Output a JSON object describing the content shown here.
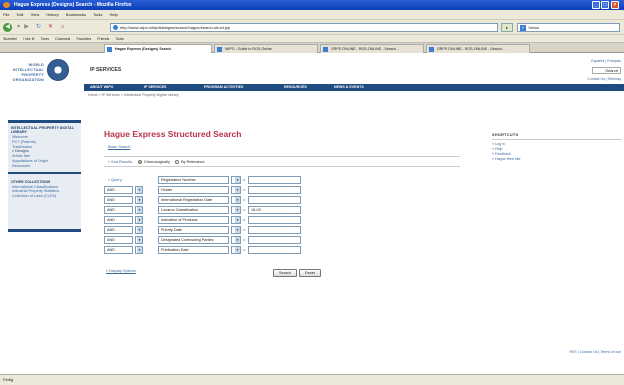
{
  "window": {
    "title": "Hague Express (Designs) Search - Mozilla Firefox"
  },
  "menu": [
    "File",
    "Edit",
    "View",
    "History",
    "Bookmarks",
    "Tools",
    "Help"
  ],
  "nav": {
    "url": "http://www.wipo.int/ipdldesigns/search/hague/search-struct.jsp",
    "go": "▸",
    "search_placeholder": "Yahoo",
    "search_engine": "Y"
  },
  "bookmarks": [
    "Stumble!",
    "I like it!",
    "Tools",
    "Channels",
    "Favorites",
    "Friends",
    "Tools"
  ],
  "tabs": [
    {
      "label": "Hague Express (Designs) Search"
    },
    {
      "label": "WIPO - Guide to ROS-Online"
    },
    {
      "label": "GRPS ONLINE - ROS-ONLINE - Search..."
    },
    {
      "label": "GRPS ONLINE - ROS-ONLINE - Search..."
    }
  ],
  "header": {
    "logo_lines": [
      "WORLD",
      "INTELLECTUAL",
      "PROPERTY",
      "ORGANIZATION"
    ],
    "ip_services": "IP SERVICES",
    "lang": "Español | Français",
    "search_btn": "Search",
    "contact": "Contact Us | Sitemap"
  },
  "topnav": [
    "ABOUT WIPO",
    "IP SERVICES",
    "PROGRAM ACTIVITIES",
    "RESOURCES",
    "NEWS & EVENTS"
  ],
  "breadcrumb": "Home > IP Services > Intellectual Property Digital Library",
  "left": {
    "heading1": "INTELLECTUAL PROPERTY DIGITAL LIBRARY",
    "items1": [
      "Welcome",
      "PCT (Patents)",
      "Trademarks",
      "» Designs",
      "Article 6ter",
      "Appellations of Origin",
      "Resources"
    ],
    "heading2": "OTHER COLLECTIONS",
    "items2": [
      "International Classifications",
      "Industrial Property Statistics",
      "Collection of Laws (CLEA)"
    ]
  },
  "main": {
    "title": "Hague Express Structured Search",
    "basic_link": "Basic Search",
    "sort_label": "» Sort Results:",
    "sort_chrono": "Chronologically",
    "sort_relevance": "By Relevance",
    "query_label": "» Query:",
    "rows": [
      {
        "op": "",
        "field": "Registration Number",
        "eq": "=",
        "value": ""
      },
      {
        "op": "AND",
        "field": "Holder",
        "eq": "=",
        "value": ""
      },
      {
        "op": "AND",
        "field": "International Registration Date",
        "eq": "=",
        "value": ""
      },
      {
        "op": "AND",
        "field": "Locarno Classification",
        "eq": "=",
        "value": "16-03"
      },
      {
        "op": "AND",
        "field": "Indication of Products",
        "eq": "=",
        "value": ""
      },
      {
        "op": "AND",
        "field": "Priority Date",
        "eq": "=",
        "value": ""
      },
      {
        "op": "AND",
        "field": "Designated Contracting Parties",
        "eq": "=",
        "value": ""
      },
      {
        "op": "AND",
        "field": "Publication Date",
        "eq": "=",
        "value": ""
      }
    ],
    "display_options": "» Display Options",
    "search_button": "Search",
    "reset_button": "Reset"
  },
  "shortcuts": {
    "heading": "SHORTCUTS",
    "links": [
      "» Log in",
      "» Help",
      "» Feedback",
      "» Hague Web site"
    ]
  },
  "footer": {
    "links": "RSS | Contact Us | Terms of use"
  },
  "status": {
    "text": "Fertig"
  }
}
